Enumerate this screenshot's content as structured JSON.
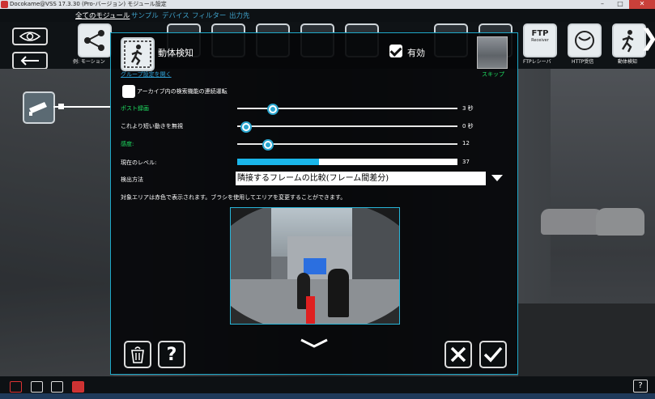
{
  "window": {
    "title": "Docokame@VSS 17.3.30 (Pro-バージョン) モジュール設定",
    "minimize": "–",
    "maximize": "□",
    "close": "✕"
  },
  "menu": [
    {
      "label": "全てのモジュール",
      "active": true
    },
    {
      "label": "サンプル",
      "active": false
    },
    {
      "label": "デバイス",
      "active": false
    },
    {
      "label": "フィルター",
      "active": false
    },
    {
      "label": "出力先",
      "active": false
    }
  ],
  "toolbar": {
    "first_label": "例: モーション",
    "right_labels": [
      "FTPレシーバ",
      "HTTP受信",
      "動体検知"
    ],
    "ftp_icon_text": "FTP",
    "ftp_icon_sub": "Receiver"
  },
  "dialog": {
    "title": "動体検知",
    "enabled_label": "有効",
    "enabled": true,
    "skip_label": "スキップ",
    "group_link": "グループ設定を開く",
    "archive_label": "アーカイブ内の検索機能の連続運転",
    "archive_checked": false,
    "rows": [
      {
        "label": "ポスト録画",
        "value": "3 秒",
        "highlight": true,
        "position": 0.16
      },
      {
        "label": "これより短い動きを無視",
        "value": "0 秒",
        "highlight": false,
        "position": 0.04
      },
      {
        "label": "感度:",
        "value": "12",
        "highlight": true,
        "position": 0.14
      }
    ],
    "level_label": "現在のレベル:",
    "level_value": "37",
    "level_fraction": 0.37,
    "method_label": "検出方法",
    "method_value": "隣接するフレームの比較(フレーム間差分)",
    "note": "対象エリアは赤色で表示されます。ブラシを使用してエリアを変更することができます。"
  },
  "colors": {
    "accent": "#1ea7c7",
    "green": "#1ee062",
    "level": "#1ab6ea",
    "mask": "#e02020"
  },
  "footer": {
    "help": "?"
  }
}
